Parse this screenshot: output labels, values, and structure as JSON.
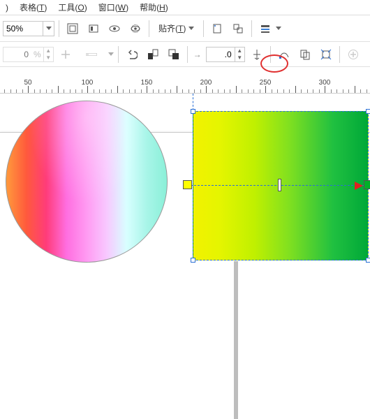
{
  "menu": {
    "items": [
      {
        "key": "c",
        "label": ")"
      },
      {
        "key": "t",
        "label": "表格",
        "accel": "T"
      },
      {
        "key": "o",
        "label": "工具",
        "accel": "O"
      },
      {
        "key": "w",
        "label": "窗口",
        "accel": "W"
      },
      {
        "key": "h",
        "label": "帮助",
        "accel": "H"
      }
    ]
  },
  "toolbar1": {
    "zoom": "50%",
    "snap_label": "贴齐",
    "snap_accel": "T"
  },
  "toolbar2": {
    "opacity_suffix": "%",
    "value": ".0"
  },
  "ruler": {
    "unit_spacing": 85,
    "labels": [
      "50",
      "100",
      "150",
      "200",
      "250",
      "300"
    ],
    "firstX": 40
  },
  "shapes": {
    "circle_gradient": "rainbow",
    "rect_gradient": [
      "#f2f200",
      "#00a838"
    ]
  }
}
